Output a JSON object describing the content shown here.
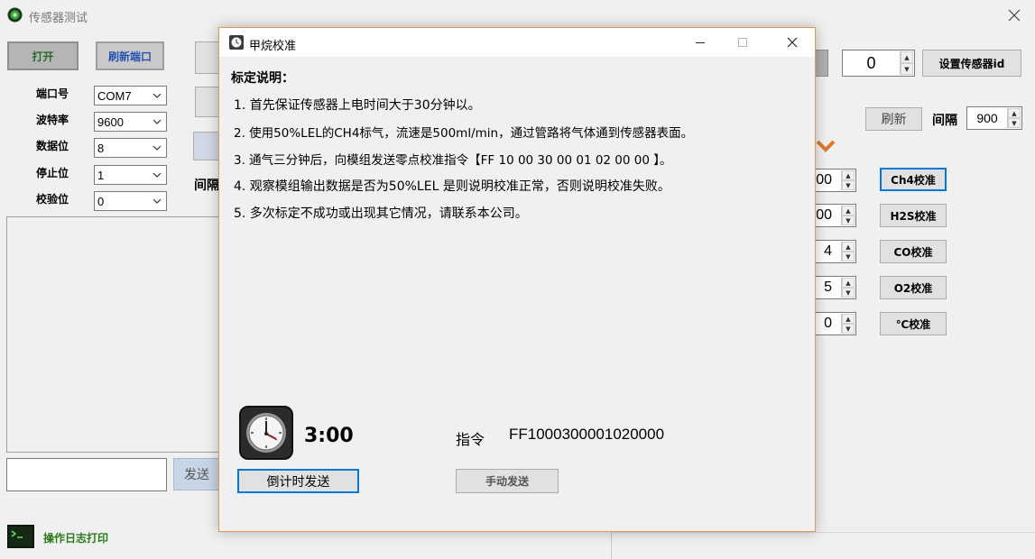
{
  "window": {
    "title": "传感器测试"
  },
  "left": {
    "open_label": "打开",
    "refresh_ports_label": "刷新端口",
    "fields": [
      {
        "label": "端口号",
        "value": "COM7"
      },
      {
        "label": "波特率",
        "value": "9600"
      },
      {
        "label": "数据位",
        "value": "8"
      },
      {
        "label": "停止位",
        "value": "1"
      },
      {
        "label": "校验位",
        "value": "0"
      }
    ],
    "interval_label": "间隔",
    "send_input_value": "",
    "send_label": "发送",
    "log_label": "操作日志打印"
  },
  "right": {
    "sensor_id_value": "0",
    "set_sensor_id_label": "设置传感器id",
    "refresh_label": "刷新",
    "interval_label": "间隔",
    "interval_value": "900",
    "cal_values": [
      "00",
      "00",
      "4",
      "5",
      "0"
    ],
    "cal_buttons": [
      "Ch4校准",
      "H2S校准",
      "CO校准",
      "O2校准",
      "℃校准"
    ]
  },
  "dialog": {
    "title": "甲烷校准",
    "heading": "标定说明：",
    "lines": [
      "1. 首先保证传感器上电时间大于30分钟以。",
      "2. 使用50%LEL的CH4标气，流速是500ml/min，通过管路将气体通到传感器表面。",
      "3. 通气三分钟后，向模组发送零点校准指令【FF 10 00 30 00 01 02 00 00 】。",
      "4. 观察模组输出数据是否为50%LEL 是则说明校准正常，否则说明校准失败。",
      "5. 多次标定不成功或出现其它情况，请联系本公司。"
    ],
    "timer": "3:00",
    "command_label": "指令",
    "command_value": "FF1000300001020000",
    "countdown_send_label": "倒计时发送",
    "manual_send_label": "手动发送"
  },
  "colors": {
    "dialog_border": "#e09a52",
    "focus_border": "#0078d7",
    "log_green": "#2a7a1c"
  }
}
